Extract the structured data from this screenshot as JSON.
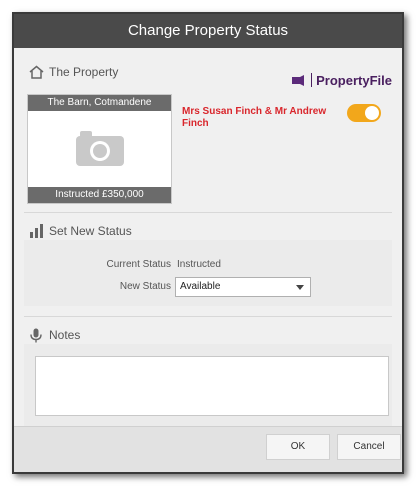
{
  "dialog": {
    "title": "Change Property Status"
  },
  "property_section": {
    "heading": "The Property",
    "brand": "PropertyFile",
    "property_name": "The Barn, Cotmandene",
    "property_price": "Instructed £350,000",
    "owners": "Mrs Susan Finch & Mr Andrew Finch",
    "toggle_on": true
  },
  "status_section": {
    "heading": "Set New Status",
    "current_label": "Current Status",
    "current_value": "Instructed",
    "new_label": "New Status",
    "new_value": "Available"
  },
  "notes_section": {
    "heading": "Notes",
    "value": ""
  },
  "footer": {
    "ok_label": "OK",
    "cancel_label": "Cancel"
  },
  "colors": {
    "title_bar": "#4a4a4a",
    "accent_toggle": "#f2a71b",
    "owner_text": "#d9262c",
    "brand": "#4a2060"
  }
}
